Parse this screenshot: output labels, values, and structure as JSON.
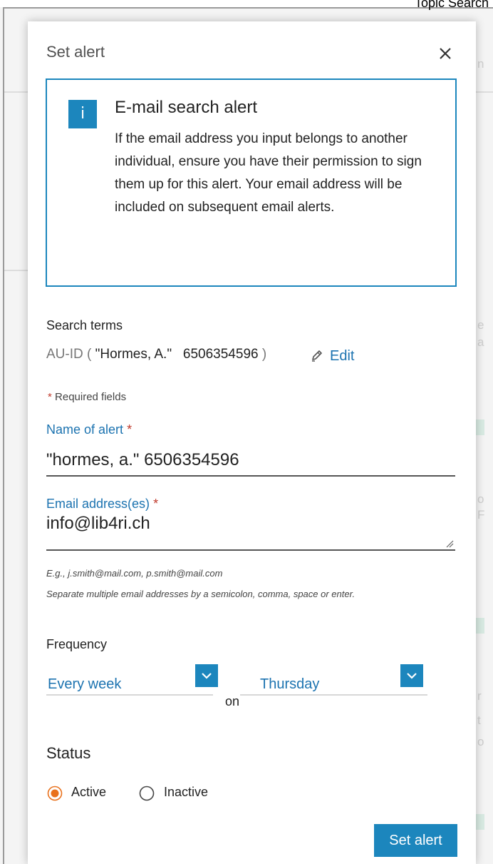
{
  "corner_label": "Topic Search",
  "modal": {
    "title": "Set alert",
    "close_icon": "close-icon"
  },
  "info": {
    "icon": "i",
    "heading": "E-mail search alert",
    "text": "If the email address you input belongs to another individual, ensure you have their permission to sign them up for this alert. Your email address will be included on subsequent email alerts."
  },
  "search_terms": {
    "label": "Search terms",
    "prefix": "AU-ID (",
    "value": "\"Hormes, A.\"   6506354596",
    "suffix": ")",
    "edit_label": "Edit",
    "edit_icon": "pencil-icon"
  },
  "required_note": {
    "star": "*",
    "text": "Required fields"
  },
  "name_field": {
    "label": "Name of alert",
    "star": "*",
    "value": "\"hormes, a.\" 6506354596"
  },
  "email_field": {
    "label": "Email address(es)",
    "star": "*",
    "value": "info@lib4ri.ch",
    "hint1": "E.g., j.smith@mail.com, p.smith@mail.com",
    "hint2": "Separate multiple email addresses by a semicolon, comma, space or enter."
  },
  "frequency": {
    "label": "Frequency",
    "interval_value": "Every week",
    "on_label": "on",
    "day_value": "Thursday"
  },
  "status": {
    "heading": "Status",
    "options": [
      {
        "label": "Active",
        "selected": true
      },
      {
        "label": "Inactive",
        "selected": false
      }
    ]
  },
  "submit_label": "Set alert",
  "colors": {
    "accent": "#1c86bd",
    "link": "#1c73b0",
    "required": "#c0392b",
    "radio_selected": "#e9711c"
  }
}
